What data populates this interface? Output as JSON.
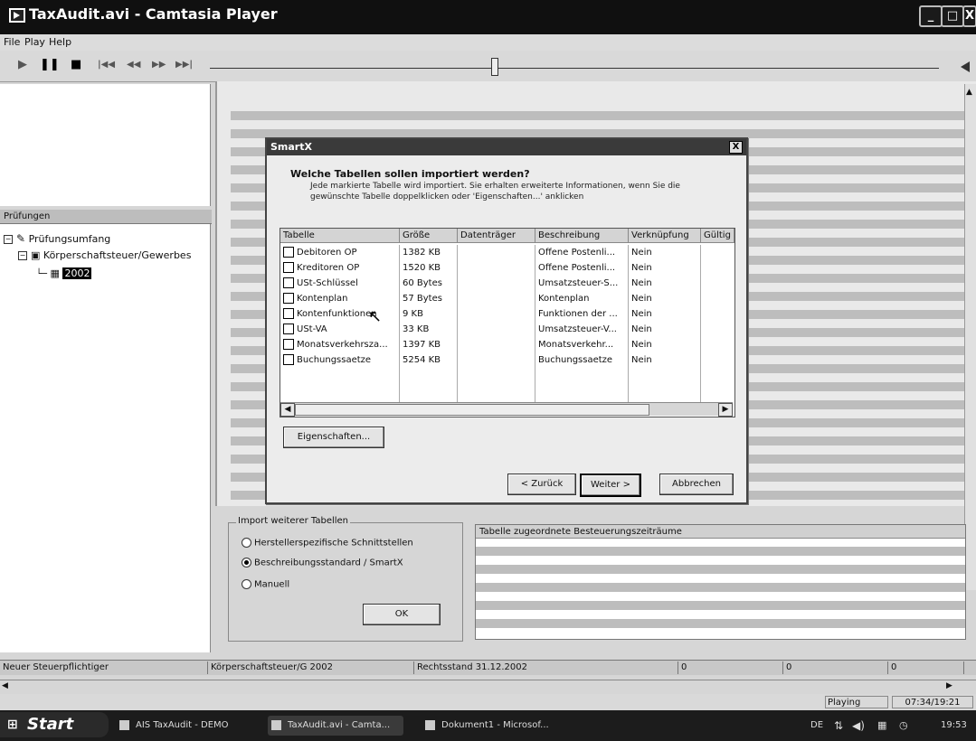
{
  "window": {
    "title": "TaxAudit.avi - Camtasia Player",
    "minimize": "_",
    "maximize": "□",
    "close": "X"
  },
  "menu": [
    "File",
    "Play",
    "Help"
  ],
  "player_controls": {
    "play": "▶",
    "pause": "❚❚",
    "stop": "■",
    "start": "|◀◀",
    "rewind": "◀◀",
    "forward": "▶▶",
    "end": "▶▶|",
    "volume_icon": "speaker-icon",
    "seek_position": 0.39
  },
  "left_panel": {
    "header": "Prüfungen",
    "tree": [
      {
        "label": "Prüfungsumfang",
        "toggle": "−"
      },
      {
        "label": "Körperschaftsteuer/Gewerbes",
        "toggle": "−"
      },
      {
        "label": "2002",
        "selected": true
      }
    ]
  },
  "dialog": {
    "title": "SmartX",
    "close": "X",
    "heading": "Welche Tabellen sollen importiert werden?",
    "description": "Jede markierte Tabelle wird importiert. Sie erhalten erweiterte Informationen, wenn Sie die gewünschte Tabelle doppelklicken oder 'Eigenschaften...' anklicken",
    "columns": [
      "Tabelle",
      "Größe",
      "Datenträger",
      "Beschreibung",
      "Verknüpfung",
      "Gültig"
    ],
    "rows": [
      {
        "name": "Debitoren OP",
        "size": "1382 KB",
        "medium": "",
        "desc": "Offene Postenli...",
        "link": "Nein"
      },
      {
        "name": "Kreditoren OP",
        "size": "1520 KB",
        "medium": "",
        "desc": "Offene Postenli...",
        "link": "Nein"
      },
      {
        "name": "USt-Schlüssel",
        "size": "60 Bytes",
        "medium": "",
        "desc": "Umsatzsteuer-S...",
        "link": "Nein"
      },
      {
        "name": "Kontenplan",
        "size": "57 Bytes",
        "medium": "",
        "desc": "Kontenplan",
        "link": "Nein"
      },
      {
        "name": "Kontenfunktionen",
        "size": "9 KB",
        "medium": "",
        "desc": "Funktionen der ...",
        "link": "Nein"
      },
      {
        "name": "USt-VA",
        "size": "33 KB",
        "medium": "",
        "desc": "Umsatzsteuer-V...",
        "link": "Nein"
      },
      {
        "name": "Monatsverkehrsza...",
        "size": "1397 KB",
        "medium": "",
        "desc": "Monatsverkehr...",
        "link": "Nein"
      },
      {
        "name": "Buchungssaetze",
        "size": "5254 KB",
        "medium": "",
        "desc": "Buchungssaetze",
        "link": "Nein"
      }
    ],
    "properties_button": "Eigenschaften...",
    "back_button": "< Zurück",
    "next_button": "Weiter >",
    "cancel_button": "Abbrechen"
  },
  "import_group": {
    "legend": "Import weiterer Tabellen",
    "options": [
      {
        "label": "Herstellerspezifische Schnittstellen",
        "checked": false
      },
      {
        "label": "Beschreibungsstandard / SmartX",
        "checked": true
      },
      {
        "label": "Manuell",
        "checked": false
      }
    ],
    "ok_button": "OK"
  },
  "periods_panel": {
    "header": "Tabelle  zugeordnete Besteuerungszeiträume"
  },
  "status_bar": {
    "new_taxpayer": "Neuer Steuerpflichtiger",
    "context": "Körperschaftsteuer/G 2002",
    "legal_status": "Rechtsstand 31.12.2002",
    "count1": "0",
    "count2": "0",
    "count3": "0"
  },
  "player_status": {
    "state": "Playing",
    "time": "07:34/19:21"
  },
  "taskbar": {
    "start": "Start",
    "tasks": [
      "AIS TaxAudit - DEMO",
      "TaxAudit.avi - Camta...",
      "Dokument1 - Microsof..."
    ],
    "tray_lang": "DE",
    "clock": "19:53"
  }
}
